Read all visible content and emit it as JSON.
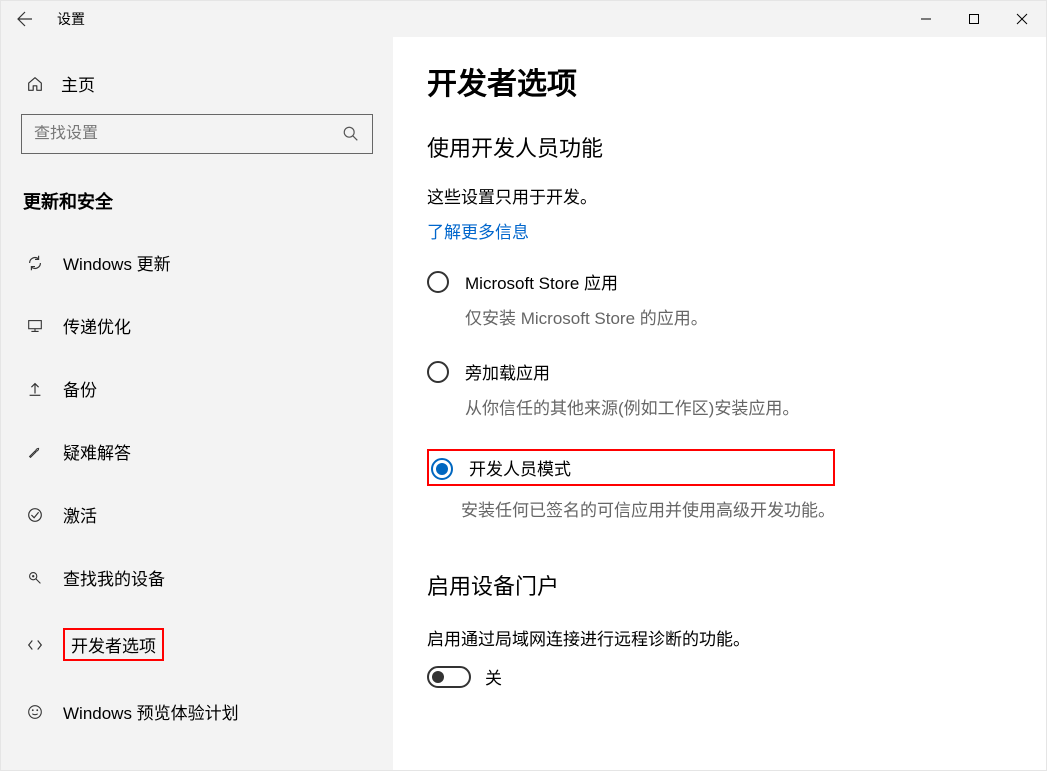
{
  "window": {
    "title": "设置"
  },
  "sidebar": {
    "home": "主页",
    "search_placeholder": "查找设置",
    "category": "更新和安全",
    "items": [
      {
        "label": "Windows 更新"
      },
      {
        "label": "传递优化"
      },
      {
        "label": "备份"
      },
      {
        "label": "疑难解答"
      },
      {
        "label": "激活"
      },
      {
        "label": "查找我的设备"
      },
      {
        "label": "开发者选项",
        "highlighted": true
      },
      {
        "label": "Windows 预览体验计划"
      }
    ]
  },
  "main": {
    "title": "开发者选项",
    "section1": {
      "title": "使用开发人员功能",
      "desc": "这些设置只用于开发。",
      "link": "了解更多信息",
      "options": [
        {
          "label": "Microsoft Store 应用",
          "desc": "仅安装 Microsoft Store 的应用。",
          "selected": false
        },
        {
          "label": "旁加载应用",
          "desc": "从你信任的其他来源(例如工作区)安装应用。",
          "selected": false
        },
        {
          "label": "开发人员模式",
          "desc": "安装任何已签名的可信应用并使用高级开发功能。",
          "selected": true,
          "highlighted": true
        }
      ]
    },
    "section2": {
      "title": "启用设备门户",
      "desc": "启用通过局域网连接进行远程诊断的功能。",
      "toggle_state": "关"
    }
  }
}
